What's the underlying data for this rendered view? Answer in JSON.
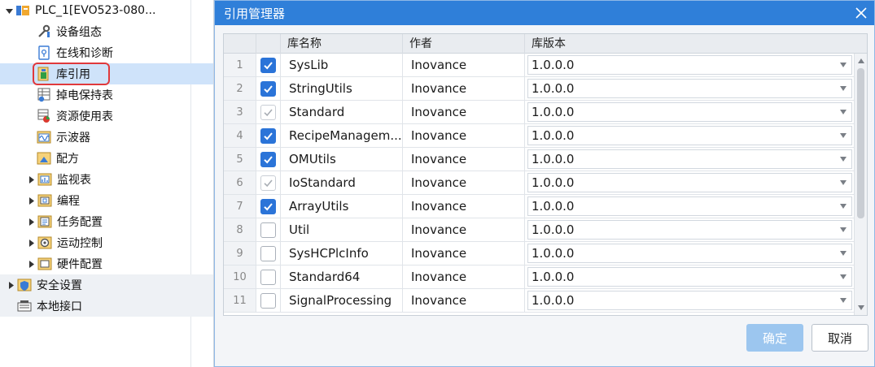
{
  "tree": {
    "items": [
      {
        "label": "PLC_1[EVO523-080...",
        "icon": "plc-icon",
        "expand": "down"
      },
      {
        "label": "设备组态",
        "icon": "device-config-icon",
        "expand": ""
      },
      {
        "label": "在线和诊断",
        "icon": "online-diagnostics-icon",
        "expand": ""
      },
      {
        "label": "库引用",
        "icon": "library-reference-icon",
        "expand": ""
      },
      {
        "label": "掉电保持表",
        "icon": "power-retain-table-icon",
        "expand": ""
      },
      {
        "label": "资源使用表",
        "icon": "resource-usage-icon",
        "expand": ""
      },
      {
        "label": "示波器",
        "icon": "oscilloscope-icon",
        "expand": ""
      },
      {
        "label": "配方",
        "icon": "recipe-icon",
        "expand": ""
      },
      {
        "label": "监视表",
        "icon": "watch-table-icon",
        "expand": "right"
      },
      {
        "label": "编程",
        "icon": "programming-icon",
        "expand": "right"
      },
      {
        "label": "任务配置",
        "icon": "task-config-icon",
        "expand": "right"
      },
      {
        "label": "运动控制",
        "icon": "motion-control-icon",
        "expand": "right"
      },
      {
        "label": "硬件配置",
        "icon": "hardware-config-icon",
        "expand": "right"
      },
      {
        "label": "安全设置",
        "icon": "security-settings-icon",
        "expand": "right"
      },
      {
        "label": "本地接口",
        "icon": "local-interface-icon",
        "expand": ""
      }
    ]
  },
  "dialog": {
    "title": "引用管理器",
    "columns": [
      "库名称",
      "作者",
      "库版本"
    ],
    "rows": [
      {
        "num": "1",
        "checked": "on",
        "name": "SysLib",
        "author": "Inovance",
        "version": "1.0.0.0"
      },
      {
        "num": "2",
        "checked": "on",
        "name": "StringUtils",
        "author": "Inovance",
        "version": "1.0.0.0"
      },
      {
        "num": "3",
        "checked": "dis",
        "name": "Standard",
        "author": "Inovance",
        "version": "1.0.0.0"
      },
      {
        "num": "4",
        "checked": "on",
        "name": "RecipeManagem...",
        "author": "Inovance",
        "version": "1.0.0.0"
      },
      {
        "num": "5",
        "checked": "on",
        "name": "OMUtils",
        "author": "Inovance",
        "version": "1.0.0.0"
      },
      {
        "num": "6",
        "checked": "dis",
        "name": "IoStandard",
        "author": "Inovance",
        "version": "1.0.0.0"
      },
      {
        "num": "7",
        "checked": "on",
        "name": "ArrayUtils",
        "author": "Inovance",
        "version": "1.0.0.0"
      },
      {
        "num": "8",
        "checked": "off",
        "name": "Util",
        "author": "Inovance",
        "version": "1.0.0.0"
      },
      {
        "num": "9",
        "checked": "off",
        "name": "SysHCPlcInfo",
        "author": "Inovance",
        "version": "1.0.0.0"
      },
      {
        "num": "10",
        "checked": "off",
        "name": "Standard64",
        "author": "Inovance",
        "version": "1.0.0.0"
      },
      {
        "num": "11",
        "checked": "off",
        "name": "SignalProcessing",
        "author": "Inovance",
        "version": "1.0.0.0"
      }
    ],
    "ok_label": "确定",
    "cancel_label": "取消"
  },
  "colors": {
    "title_bar": "#2f7fd9",
    "checkbox_on": "#2b74d8",
    "selection": "#cfe3fa",
    "highlight_box": "#e0393c"
  }
}
